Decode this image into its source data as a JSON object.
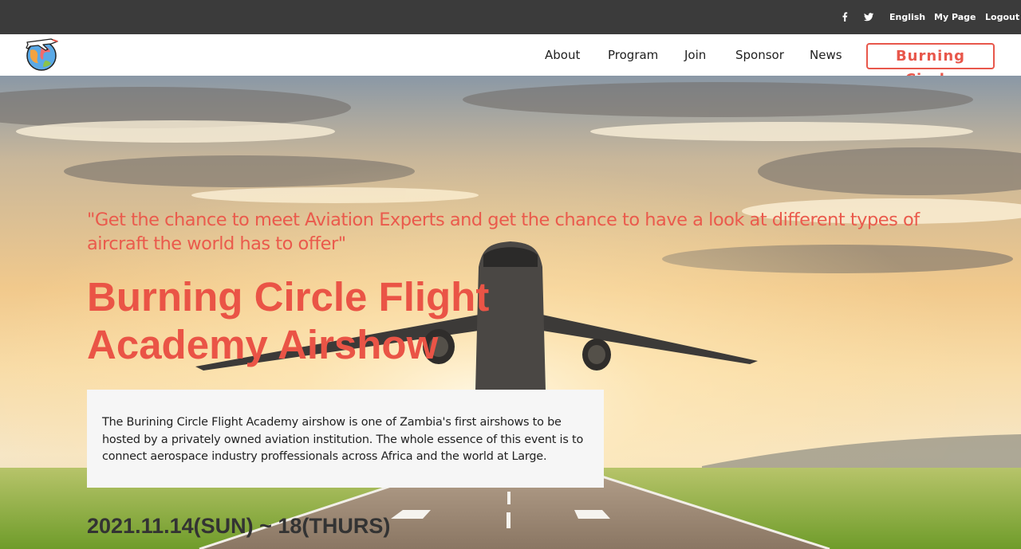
{
  "topbar": {
    "icons": [
      "facebook-icon",
      "twitter-icon"
    ],
    "language": "English",
    "my_page": "My Page",
    "logout": "Logout"
  },
  "nav": {
    "items": [
      "About",
      "Program",
      "Join",
      "Sponsor",
      "News"
    ],
    "cta": "Burning Circle"
  },
  "hero": {
    "tagline": "\"Get the chance to meet Aviation Experts and get the chance to have a look at different types of aircraft the world has to offer\"",
    "title_line1": "Burning Circle Flight",
    "title_line2": "Academy Airshow",
    "description": "The Burining Circle Flight Academy airshow is one of Zambia's first airshows to be hosted by a privately owned aviation institution. The whole essence of this event is to connect aerospace industry proffessionals across Africa and the world at Large.",
    "date": "2021.11.14(SUN) ~ 18(THURS)"
  },
  "colors": {
    "accent": "#ea5446",
    "topbar_bg": "#3b3b3b",
    "nav_bg": "#ffffff",
    "desc_bg": "#f6f6f6"
  }
}
